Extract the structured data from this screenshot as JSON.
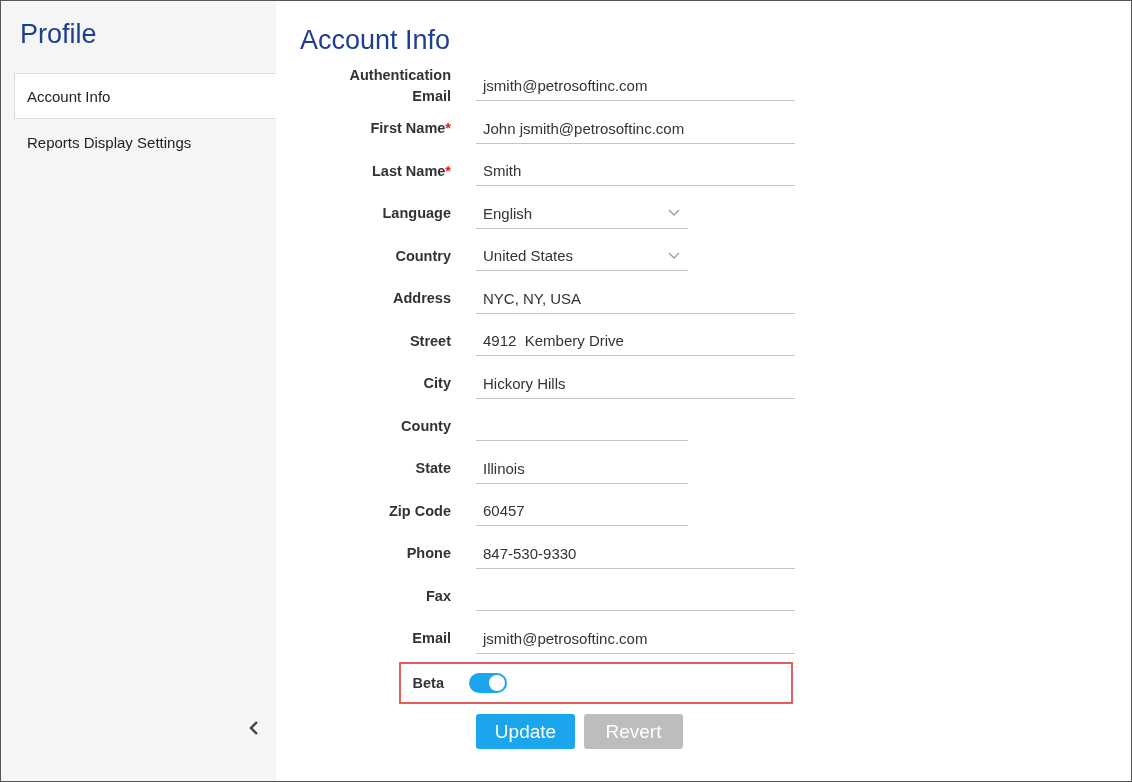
{
  "sidebar": {
    "title": "Profile",
    "items": [
      {
        "label": "Account Info",
        "selected": true
      },
      {
        "label": "Reports Display Settings",
        "selected": false
      }
    ]
  },
  "form": {
    "title": "Account Info",
    "fields": [
      {
        "label": "Authentication Email",
        "kind": "text",
        "wide": true,
        "value": "jsmith@petrosoftinc.com"
      },
      {
        "label": "First Name",
        "required_mark": "*",
        "kind": "text",
        "wide": true,
        "value": "John jsmith@petrosoftinc.com"
      },
      {
        "label": "Last Name",
        "required_mark": "*",
        "kind": "text",
        "wide": true,
        "value": "Smith"
      },
      {
        "label": "Language",
        "kind": "select",
        "wide": false,
        "value": "English"
      },
      {
        "label": "Country",
        "kind": "select",
        "wide": false,
        "value": "United States"
      },
      {
        "label": "Address",
        "kind": "text",
        "wide": true,
        "value": "NYC, NY, USA"
      },
      {
        "label": "Street",
        "kind": "text",
        "wide": true,
        "value": "4912  Kembery Drive"
      },
      {
        "label": "City",
        "kind": "text",
        "wide": true,
        "value": "Hickory Hills"
      },
      {
        "label": "County",
        "kind": "text",
        "wide": false
      },
      {
        "label": "State",
        "kind": "text",
        "wide": false,
        "value": "Illinois"
      },
      {
        "label": "Zip Code",
        "kind": "text",
        "wide": false,
        "value": "60457"
      },
      {
        "label": "Phone",
        "kind": "text",
        "wide": true,
        "value": "847-530-9330"
      },
      {
        "label": "Fax",
        "kind": "text",
        "wide": true
      },
      {
        "label": "Email",
        "kind": "text",
        "wide": true,
        "value": "jsmith@petrosoftinc.com"
      }
    ],
    "beta": {
      "label": "Beta",
      "on": true,
      "highlighted": true
    },
    "buttons": [
      {
        "label": "Update",
        "disabled": false
      },
      {
        "label": "Revert",
        "disabled": true
      }
    ]
  }
}
